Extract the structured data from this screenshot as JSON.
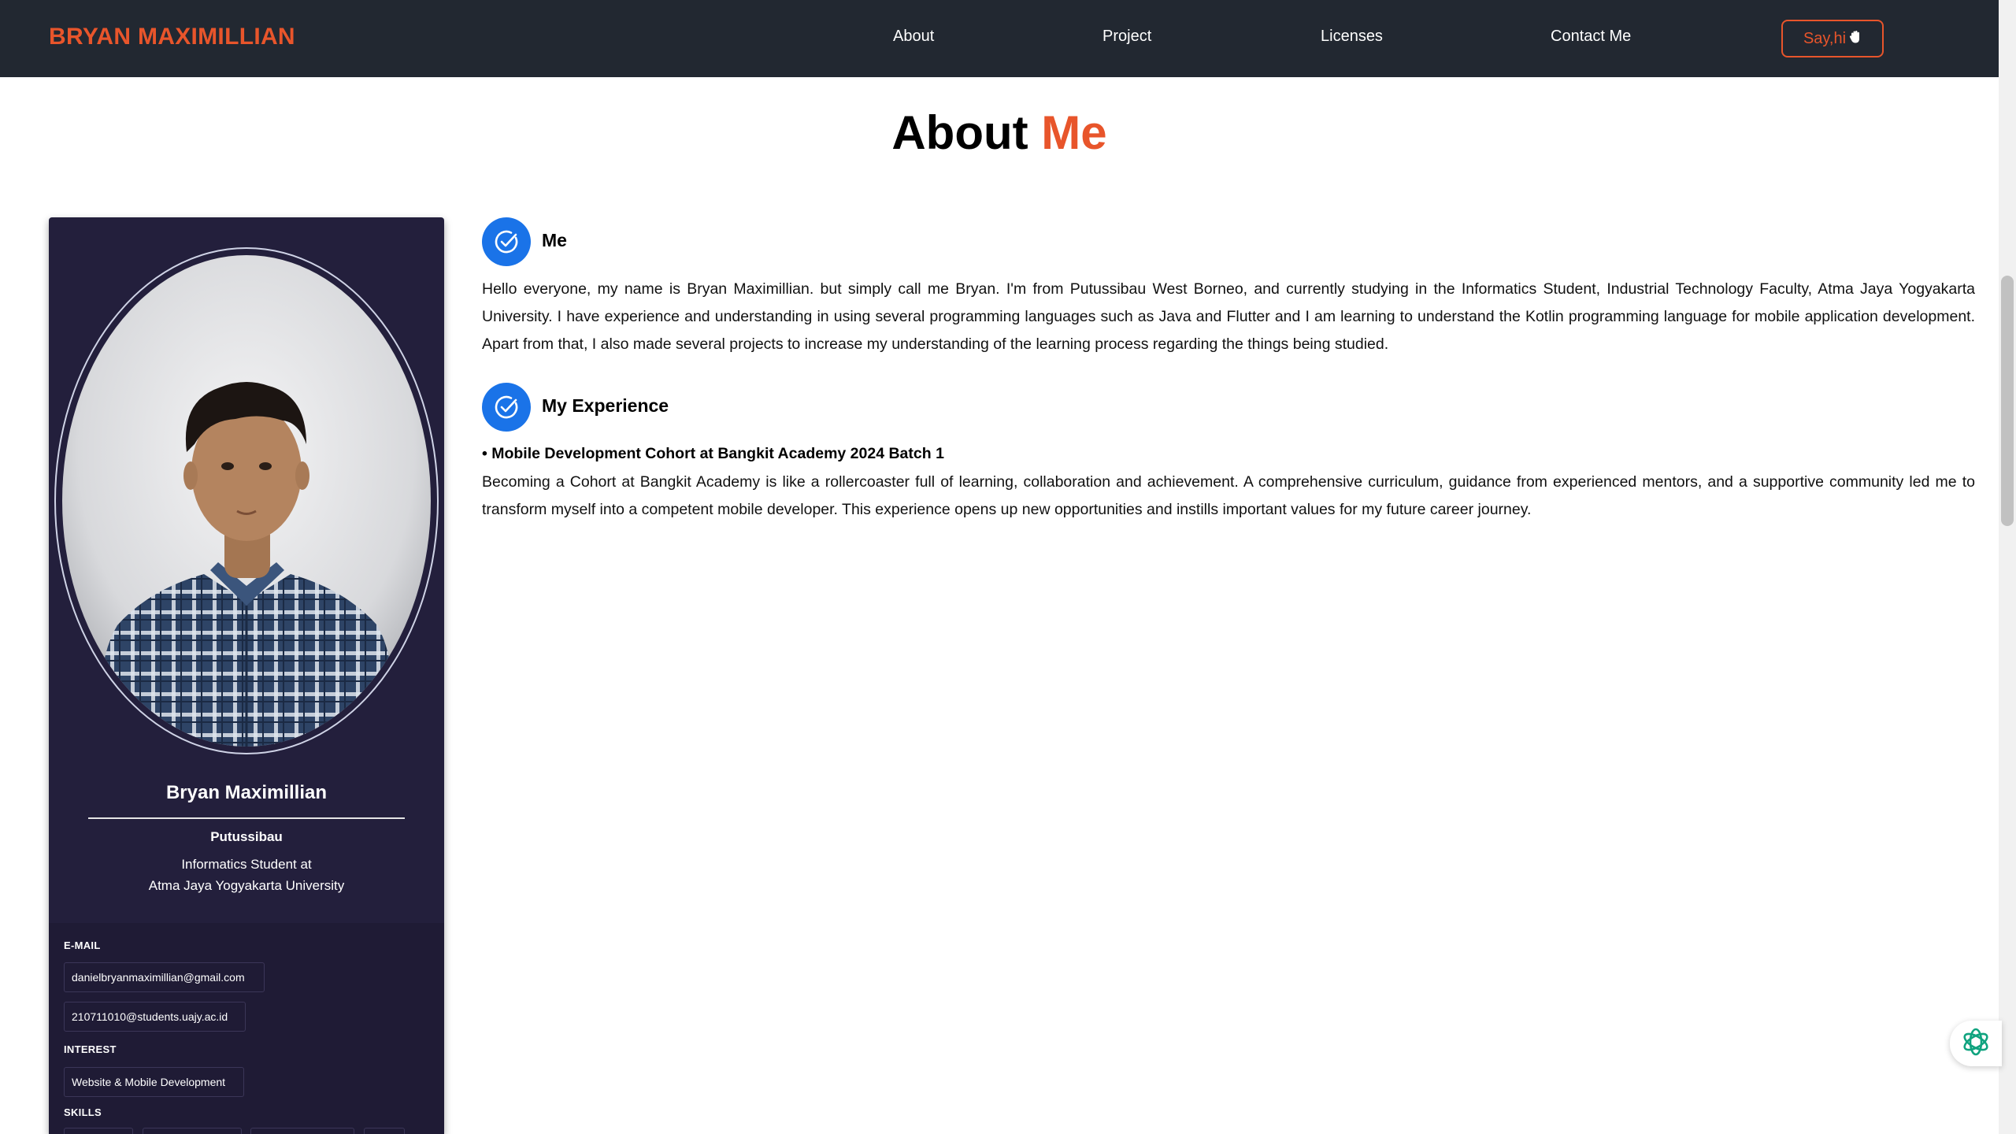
{
  "navbar": {
    "brand": "BRYAN MAXIMILLIAN",
    "links": [
      "About",
      "Project",
      "Licenses",
      "Contact Me"
    ],
    "cta_label": "Say,hi",
    "cta_icon": "waving-hand-icon"
  },
  "heading": {
    "main": "About",
    "accent": "Me"
  },
  "profile": {
    "name": "Bryan Maximillian",
    "city": "Putussibau",
    "role_line1": "Informatics Student at",
    "role_line2": "Atma Jaya Yogyakarta University",
    "email_label": "E-MAIL",
    "emails": [
      "danielbryanmaximillian@gmail.com",
      "210711010@students.uajy.ac.id"
    ],
    "interest_label": "INTEREST",
    "interest": "Website & Mobile Development",
    "skills_label": "SKILLS"
  },
  "sections": [
    {
      "title": "Me",
      "text": "Hello everyone, my name is Bryan Maximillian. but simply call me Bryan. I'm from Putussibau West Borneo, and currently studying in the Informatics Student, Industrial Technology Faculty, Atma Jaya Yogyakarta University. I have experience and understanding in using several programming languages such as Java and Flutter and I am learning to understand the Kotlin programming language for mobile application development. Apart from that, I also made several projects to increase my understanding of the learning process regarding the things being studied."
    },
    {
      "title": "My Experience",
      "item_title": "• Mobile Development Cohort at Bangkit Academy 2024 Batch 1",
      "text": "Becoming a Cohort at Bangkit Academy is like a rollercoaster full of learning, collaboration and achievement. A comprehensive curriculum, guidance from experienced mentors, and a supportive community led me to transform myself into a competent mobile developer. This experience opens up new opportunities and instills important values for my future career journey."
    }
  ],
  "colors": {
    "accent": "#e8552b",
    "nav_bg": "#222831",
    "card_bg": "#231f3c",
    "icon_blue": "#1a73e8"
  }
}
